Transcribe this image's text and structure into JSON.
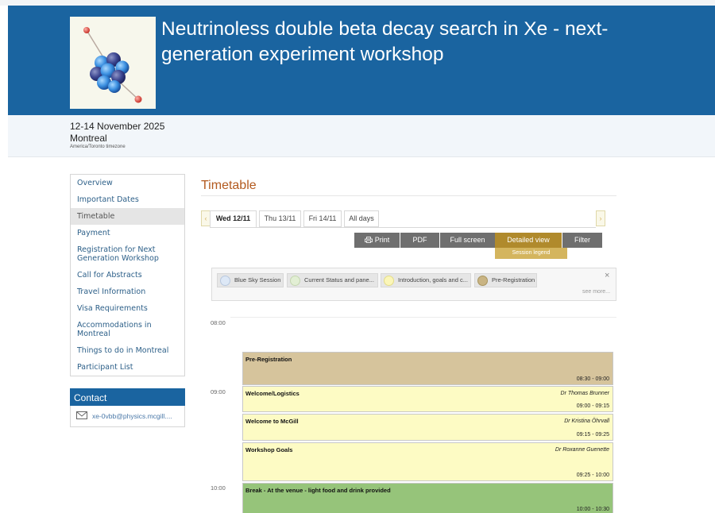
{
  "event": {
    "title": "Neutrinoless double beta decay search in Xe - next-generation experiment workshop",
    "dates": "12-14 November 2025",
    "city": "Montreal",
    "timezone": "America/Toronto timezone"
  },
  "menu": {
    "items": [
      {
        "label": "Overview"
      },
      {
        "label": "Important Dates"
      },
      {
        "label": "Timetable"
      },
      {
        "label": "Payment"
      },
      {
        "label": "Registration for Next Generation Workshop"
      },
      {
        "label": "Call for Abstracts"
      },
      {
        "label": "Travel Information"
      },
      {
        "label": "Visa Requirements"
      },
      {
        "label": "Accommodations in Montreal"
      },
      {
        "label": "Things to do in Montreal"
      },
      {
        "label": "Participant List"
      }
    ]
  },
  "contact": {
    "heading": "Contact",
    "email": "xe-0vbb@physics.mcgill...."
  },
  "timetable": {
    "title": "Timetable",
    "tabs": [
      "Wed 12/11",
      "Thu 13/11",
      "Fri 14/11",
      "All days"
    ],
    "toolbar": {
      "print": "Print",
      "pdf": "PDF",
      "fullscreen": "Full screen",
      "detailed": "Detailed view",
      "filter": "Filter",
      "legend": "Session legend"
    },
    "legend": {
      "items": [
        {
          "label": "Blue Sky Session",
          "color": "#dde8f6"
        },
        {
          "label": "Current Status and pane...",
          "color": "#e2efd4"
        },
        {
          "label": "Introduction, goals and c...",
          "color": "#fbf6b8"
        },
        {
          "label": "Pre-Registration",
          "color": "#c9b483"
        }
      ],
      "close": "×",
      "more": "see more..."
    },
    "hours": [
      "08:00",
      "09:00",
      "10:00"
    ],
    "entries": [
      {
        "title": "Pre-Registration",
        "speaker": "",
        "time": "08:30 - 09:00",
        "color": "#d6c49c"
      },
      {
        "title": "Welcome/Logistics",
        "speaker": "Dr Thomas Brunner",
        "time": "09:00 - 09:15",
        "color": "#fdfbc4"
      },
      {
        "title": "Welcome to McGill",
        "speaker": "Dr Kristina Öhrvall",
        "time": "09:15 - 09:25",
        "color": "#fdfbc4"
      },
      {
        "title": "Workshop Goals",
        "speaker": "Dr Roxanne Guenette",
        "time": "09:25 - 10:00",
        "color": "#fdfbc4"
      },
      {
        "title": "Break - At the venue - light food and drink provided",
        "speaker": "",
        "time": "10:00 - 10:30",
        "color": "#96c47a"
      }
    ]
  }
}
